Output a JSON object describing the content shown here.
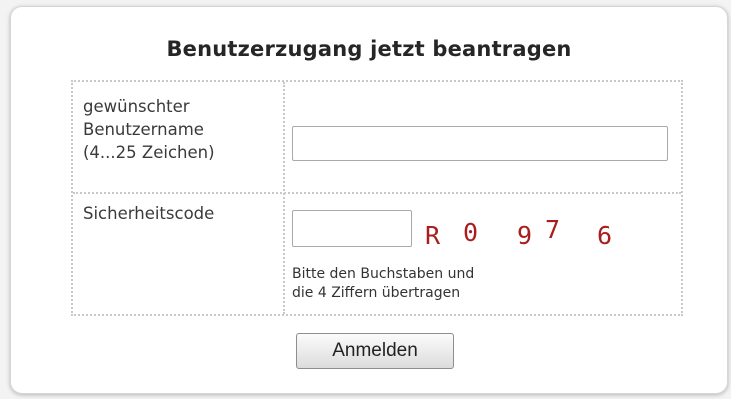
{
  "form": {
    "title": "Benutzerzugang jetzt beantragen",
    "username": {
      "label_lines": [
        "gewünschter",
        "Benutzername",
        "(4...25 Zeichen)"
      ],
      "value": "",
      "placeholder": ""
    },
    "security": {
      "label": "Sicherheitscode",
      "value": "",
      "placeholder": "",
      "captcha_chars": [
        "R",
        "0",
        "9",
        "7",
        "6"
      ],
      "captcha_color": "#a81e1e",
      "hint_lines": [
        "Bitte den Buchstaben und",
        "die 4 Ziffern übertragen"
      ]
    },
    "submit_label": "Anmelden"
  }
}
